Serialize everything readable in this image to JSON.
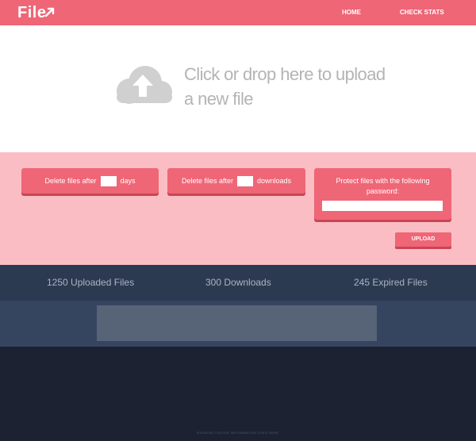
{
  "header": {
    "logo_text": "File",
    "nav": {
      "home": "HOME",
      "check_stats": "CHECK STATS"
    }
  },
  "upload": {
    "line1": "Click or drop here to upload",
    "line2": "a new file",
    "icon": "cloud-upload-icon"
  },
  "options": {
    "delete_days": {
      "prefix": "Delete files after",
      "suffix": "days",
      "value": ""
    },
    "delete_downloads": {
      "prefix": "Delete files after",
      "suffix": "downloads",
      "value": ""
    },
    "password": {
      "label": "Protect files with the following password:",
      "value": ""
    },
    "upload_button": "UPLOAD"
  },
  "stats": {
    "uploaded": "1250 Uploaded Files",
    "downloads": "300 Downloads",
    "expired": "245 Expired Files"
  },
  "footer": {
    "text": "RANDOM FOOTER INFORMATION GOES HERE"
  },
  "colors": {
    "brand": "#ef6677",
    "options_bg": "#fbbdc4",
    "stats_bg": "#2c3a51",
    "promo_bg": "#354560",
    "footer_bg": "#1c2232"
  }
}
